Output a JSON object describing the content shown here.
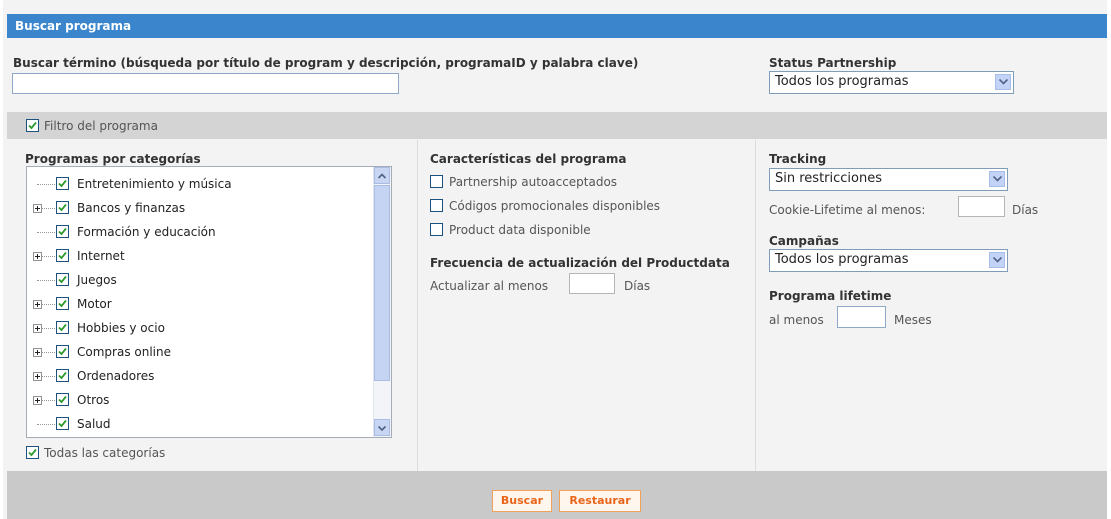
{
  "header": {
    "title": "Buscar programa"
  },
  "search": {
    "label": "Buscar término (búsqueda por título de program y descripción, programaID y palabra clave)",
    "value": ""
  },
  "status_partnership": {
    "label": "Status Partnership",
    "selected": "Todos los programas"
  },
  "filter": {
    "label": "Filtro del programa",
    "checked": true
  },
  "categories": {
    "label": "Programas por categorías",
    "items": [
      {
        "label": "Entretenimiento y música",
        "expandable": false,
        "checked": true
      },
      {
        "label": "Bancos y finanzas",
        "expandable": true,
        "checked": true
      },
      {
        "label": "Formación y educación",
        "expandable": false,
        "checked": true
      },
      {
        "label": "Internet",
        "expandable": true,
        "checked": true
      },
      {
        "label": "Juegos",
        "expandable": false,
        "checked": true
      },
      {
        "label": "Motor",
        "expandable": true,
        "checked": true
      },
      {
        "label": "Hobbies y ocio",
        "expandable": true,
        "checked": true
      },
      {
        "label": "Compras online",
        "expandable": true,
        "checked": true
      },
      {
        "label": "Ordenadores",
        "expandable": true,
        "checked": true
      },
      {
        "label": "Otros",
        "expandable": true,
        "checked": true
      },
      {
        "label": "Salud",
        "expandable": false,
        "checked": true
      }
    ],
    "all_label": "Todas las categorías"
  },
  "characteristics": {
    "label": "Características del programa",
    "options": [
      "Partnership autoacceptados",
      "Códigos promocionales disponibles",
      "Product data disponible"
    ]
  },
  "productdata": {
    "label": "Frecuencia de actualización del Productdata",
    "prefix": "Actualizar al menos",
    "suffix": "Días",
    "value": ""
  },
  "tracking": {
    "label": "Tracking",
    "selected": "Sin restricciones",
    "cookie_label": "Cookie-Lifetime al menos:",
    "cookie_suffix": "Días",
    "cookie_value": ""
  },
  "campaigns": {
    "label": "Campañas",
    "selected": "Todos los programas"
  },
  "lifetime": {
    "label": "Programa lifetime",
    "prefix": "al menos",
    "suffix": "Meses",
    "value": ""
  },
  "buttons": {
    "search": "Buscar",
    "reset": "Restaurar"
  },
  "colors": {
    "header": "#3a85cc",
    "accent_button": "#e8651b",
    "checkbox_check": "#2f9a2f"
  }
}
